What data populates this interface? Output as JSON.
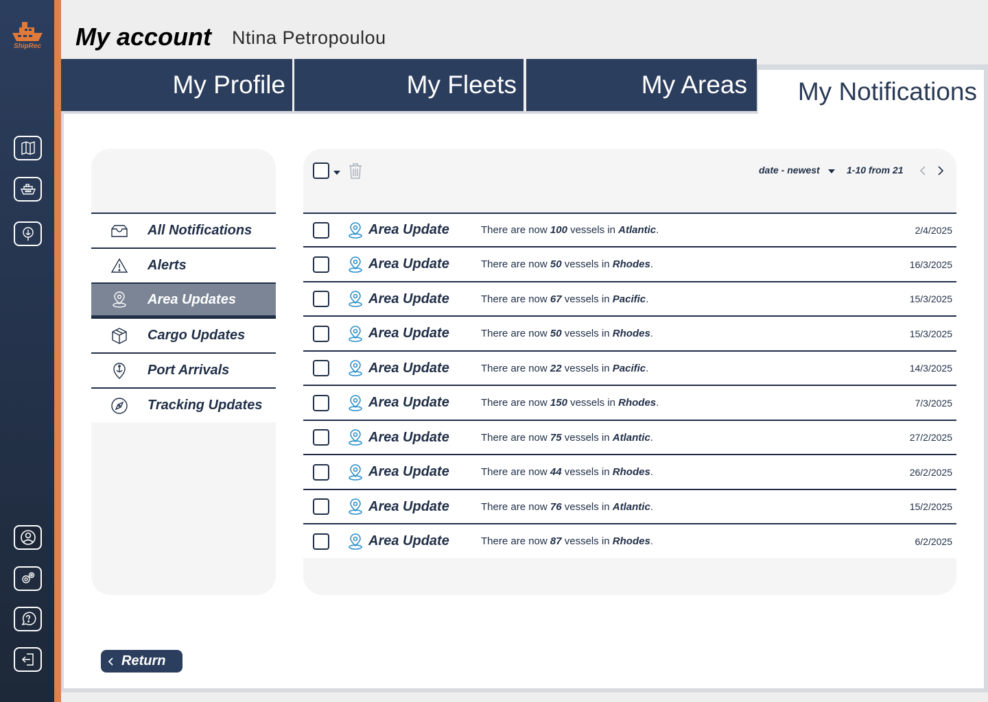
{
  "app": {
    "logo_text": "ShipRec"
  },
  "header": {
    "title": "My account",
    "user_name": "Ntina Petropoulou"
  },
  "tabs": [
    {
      "label": "My Profile",
      "active": false
    },
    {
      "label": "My Fleets",
      "active": false
    },
    {
      "label": "My Areas",
      "active": false
    },
    {
      "label": "My Notifications",
      "active": true
    }
  ],
  "sidebar": {
    "top_icons": [
      "map-icon",
      "ship-icon",
      "port-icon"
    ],
    "bottom_icons": [
      "user-icon",
      "settings-icon",
      "help-icon",
      "logout-icon"
    ]
  },
  "categories": [
    {
      "label": "All Notifications",
      "icon": "inbox-icon",
      "selected": false
    },
    {
      "label": "Alerts",
      "icon": "alert-icon",
      "selected": false
    },
    {
      "label": "Area Updates",
      "icon": "location-pin-icon",
      "selected": true
    },
    {
      "label": "Cargo Updates",
      "icon": "cargo-box-icon",
      "selected": false
    },
    {
      "label": "Port Arrivals",
      "icon": "port-anchor-icon",
      "selected": false
    },
    {
      "label": "Tracking Updates",
      "icon": "compass-icon",
      "selected": false
    }
  ],
  "toolbar": {
    "sort_label": "date - newest",
    "pager_label": "1-10 from 21"
  },
  "notifications": [
    {
      "title": "Area Update",
      "prefix": "There are now ",
      "count": "100",
      "mid": " vessels in ",
      "area": "Atlantic",
      "suffix": ".",
      "date": "2/4/2025"
    },
    {
      "title": "Area Update",
      "prefix": "There are now ",
      "count": "50",
      "mid": " vessels in ",
      "area": "Rhodes",
      "suffix": ".",
      "date": "16/3/2025"
    },
    {
      "title": "Area Update",
      "prefix": "There are now ",
      "count": "67",
      "mid": " vessels in ",
      "area": "Pacific",
      "suffix": ".",
      "date": "15/3/2025"
    },
    {
      "title": "Area Update",
      "prefix": "There are now ",
      "count": "50",
      "mid": " vessels in ",
      "area": "Rhodes",
      "suffix": ".",
      "date": "15/3/2025"
    },
    {
      "title": "Area Update",
      "prefix": "There are now ",
      "count": "22",
      "mid": " vessels in ",
      "area": "Pacific",
      "suffix": ".",
      "date": "14/3/2025"
    },
    {
      "title": "Area Update",
      "prefix": "There are now ",
      "count": "150",
      "mid": " vessels in ",
      "area": "Rhodes",
      "suffix": ".",
      "date": "7/3/2025"
    },
    {
      "title": "Area Update",
      "prefix": "There are now ",
      "count": "75",
      "mid": " vessels in ",
      "area": "Atlantic",
      "suffix": ".",
      "date": "27/2/2025"
    },
    {
      "title": "Area Update",
      "prefix": "There are now ",
      "count": "44",
      "mid": " vessels in ",
      "area": "Rhodes",
      "suffix": ".",
      "date": "26/2/2025"
    },
    {
      "title": "Area Update",
      "prefix": "There are now ",
      "count": "76",
      "mid": " vessels in ",
      "area": "Atlantic",
      "suffix": ".",
      "date": "15/2/2025"
    },
    {
      "title": "Area Update",
      "prefix": "There are now ",
      "count": "87",
      "mid": " vessels in ",
      "area": "Rhodes",
      "suffix": ".",
      "date": "6/2/2025"
    }
  ],
  "footer": {
    "return_label": "Return"
  },
  "colors": {
    "navy": "#2c3e5e",
    "accent": "#d9834d",
    "pin_blue": "#2a8fc9",
    "selected_gray": "#7b8596"
  }
}
